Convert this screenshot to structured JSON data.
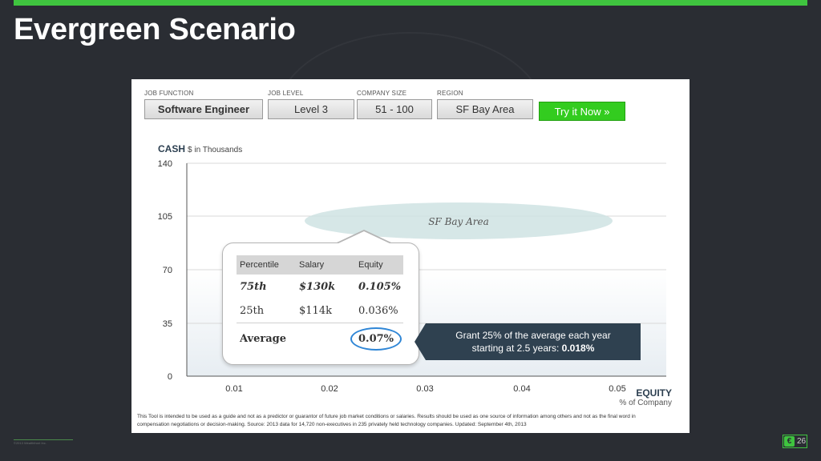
{
  "slide": {
    "title": "Evergreen Scenario",
    "page_number": "26",
    "copyright": "©2013 Wealthfront Inc.",
    "colors": {
      "accent": "#3fc43f",
      "background": "#2a2d33",
      "callout": "#2f4150"
    }
  },
  "filters": [
    {
      "label": "JOB FUNCTION",
      "value": "Software Engineer"
    },
    {
      "label": "JOB LEVEL",
      "value": "Level 3"
    },
    {
      "label": "COMPANY SIZE",
      "value": "51 - 100"
    },
    {
      "label": "REGION",
      "value": "SF Bay Area"
    }
  ],
  "try_button": {
    "label": "Try it Now »",
    "color": "#33cc1f"
  },
  "axis": {
    "y_title": "CASH",
    "y_unit": "$ in Thousands",
    "y_ticks": [
      "140",
      "105",
      "70",
      "35",
      "0"
    ],
    "x_title": "EQUITY",
    "x_unit": "% of Company",
    "x_ticks": [
      "0.01",
      "0.02",
      "0.03",
      "0.04",
      "0.05"
    ]
  },
  "region_ellipse": {
    "label": "SF Bay Area"
  },
  "popup": {
    "headers": [
      "Percentile",
      "Salary",
      "Equity"
    ],
    "rows": [
      [
        "75th",
        "$130k",
        "0.105%"
      ],
      [
        "25th",
        "$114k",
        "0.036%"
      ]
    ],
    "average": {
      "label": "Average",
      "equity": "0.07%"
    }
  },
  "callout": {
    "line1": "Grant 25% of the average each year",
    "line2_prefix": "starting at 2.5 years: ",
    "line2_value": "0.018%"
  },
  "disclaimer": "This Tool is intended to be used as a guide and not as a predictor or guarantor of future job market conditions or salaries. Results should be used as one source of information among others and not as the final word in compensation negotiations or decision-making. Source: 2013 data for 14,720 non-executives in 235 privately held technology companies. Updated: September 4th, 2013"
}
